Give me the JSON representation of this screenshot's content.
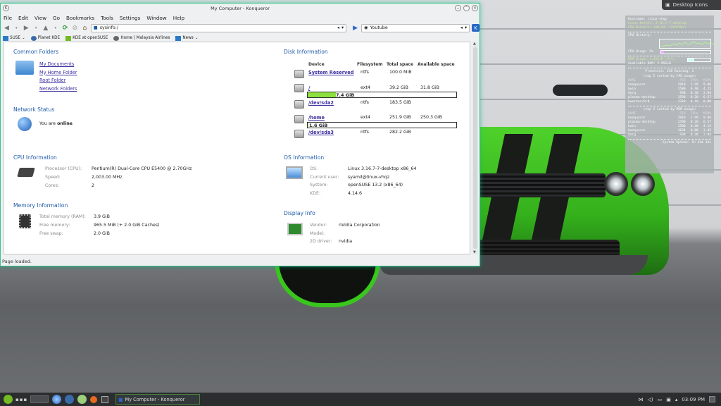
{
  "window": {
    "title": "My Computer - Konqueror",
    "menu": [
      "File",
      "Edit",
      "View",
      "Go",
      "Bookmarks",
      "Tools",
      "Settings",
      "Window",
      "Help"
    ],
    "address": "sysinfo:/",
    "search": "Youtube",
    "bookmarks": [
      "SUSE",
      "Planet KDE",
      "KDE at openSUSE",
      "Home | Malaysia Airlines",
      "News"
    ],
    "status": "Page loaded."
  },
  "common_folders": {
    "heading": "Common Folders",
    "links": [
      "My Documents",
      "My Home Folder",
      "Root Folder",
      "Network Folders"
    ]
  },
  "network": {
    "heading": "Network Status",
    "text_prefix": "You are",
    "state": "online"
  },
  "cpu": {
    "heading": "CPU Information",
    "rows": [
      {
        "label": "Processor (CPU):",
        "value": "Pentium(R) Dual-Core CPU E5400 @ 2.70GHz"
      },
      {
        "label": "Speed:",
        "value": "2,003.00 MHz"
      },
      {
        "label": "Cores:",
        "value": "2"
      }
    ]
  },
  "memory": {
    "heading": "Memory Information",
    "rows": [
      {
        "label": "Total memory (RAM):",
        "value": "3.9 GiB"
      },
      {
        "label": "Free memory:",
        "value": "965.5 MiB (+ 2.0 GiB Caches)"
      },
      {
        "label": "Free swap:",
        "value": "2.0 GiB"
      }
    ]
  },
  "disk": {
    "heading": "Disk Information",
    "columns": [
      "Device",
      "Filesystem",
      "Total space",
      "Available space"
    ],
    "rows": [
      {
        "device": "System Reserved",
        "fs": "ntfs",
        "total": "100.0 MiB",
        "avail": ""
      },
      {
        "device": "/",
        "fs": "ext4",
        "total": "39.2 GiB",
        "avail": "31.8 GiB",
        "used": "7.4 GiB",
        "fill": 0.19
      },
      {
        "device": "/dev/sda2",
        "fs": "ntfs",
        "total": "183.5 GiB",
        "avail": ""
      },
      {
        "device": "/home",
        "fs": "ext4",
        "total": "251.9 GiB",
        "avail": "250.3 GiB",
        "used": "1.6 GiB",
        "fill": 0.006
      },
      {
        "device": "/dev/sda3",
        "fs": "ntfs",
        "total": "282.2 GiB",
        "avail": ""
      }
    ]
  },
  "os": {
    "heading": "OS Information",
    "rows": [
      {
        "label": "OS:",
        "value": "Linux 3.16.7-7-desktop x86_64"
      },
      {
        "label": "Current user:",
        "value": "syamil@linux-vhqz"
      },
      {
        "label": "System:",
        "value": "openSUSE 13.2 (x86_64)"
      },
      {
        "label": "KDE:",
        "value": "4.14.6"
      }
    ]
  },
  "display": {
    "heading": "Display Info",
    "rows": [
      {
        "label": "Vendor:",
        "value": "nVidia Corporation"
      },
      {
        "label": "Model:",
        "value": ""
      },
      {
        "label": "2D driver:",
        "value": "nvidia"
      }
    ]
  },
  "conky": {
    "hostname": "Hostname: linux-vhqz",
    "kernel": "Linux Kernel: 3.16.7-7-desktop",
    "cpu_details": "CPU Details: x86_64, 1203(MHz)",
    "cpu_history": "CPU History:",
    "cpu_usage": "CPU Usage: 5%",
    "ram_usage": "RAM Usage: 1.05GiB (27%)",
    "available_ram": "Available RAM: 2.85GiB",
    "processes": "Processes: 158  Running: 2",
    "top_cpu_title": "(top 5 sorted by CPU usage)",
    "top_mem_title": "(top 5 sorted by MEM usage)",
    "table_headers": [
      "NAME",
      "PID",
      "CPU%",
      "MEM%"
    ],
    "top_cpu": [
      [
        "konqueror",
        "2010",
        "2.99",
        "9.86"
      ],
      [
        "kwin",
        "1580",
        "0.40",
        "4.15"
      ],
      [
        "Xorg",
        "930",
        "0.30",
        "2.84"
      ],
      [
        "plasma-desktop",
        "1590",
        "0.20",
        "6.57"
      ],
      [
        "kworker/0:0",
        "3310",
        "0.10",
        "0.00"
      ]
    ],
    "top_mem": [
      [
        "konqueror",
        "2010",
        "2.99",
        "9.86"
      ],
      [
        "plasma-desktop",
        "1590",
        "0.20",
        "6.57"
      ],
      [
        "kwin",
        "1580",
        "0.40",
        "4.15"
      ],
      [
        "konqueror",
        "1634",
        "0.00",
        "3.45"
      ],
      [
        "Xorg",
        "930",
        "0.30",
        "2.84"
      ]
    ],
    "uptime": "System Uptime: 1h 34m 34s",
    "cpu_usage_fill": 0.05,
    "ram_usage_fill": 0.27
  },
  "desktop_icons_label": "Desktop Icons",
  "taskbar": {
    "active_task": "My Computer - Konqueror",
    "clock": "03:09 PM"
  }
}
